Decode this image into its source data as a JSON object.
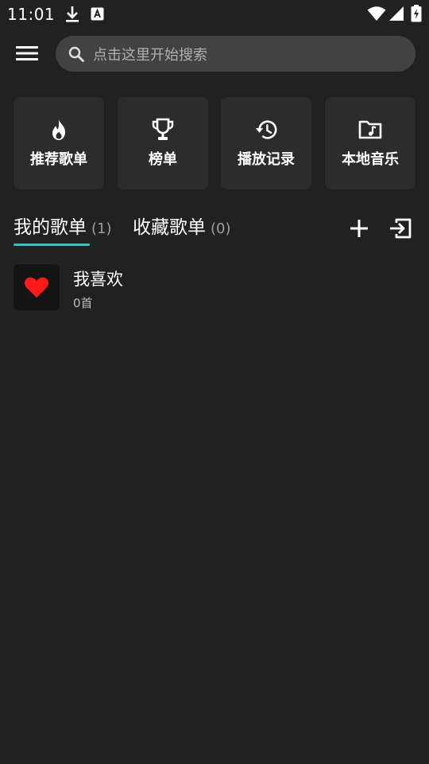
{
  "status_bar": {
    "time": "11:01",
    "icons": [
      "download-icon",
      "app-notification-icon",
      "wifi-icon",
      "signal-icon",
      "battery-charging-icon"
    ]
  },
  "top_bar": {
    "menu_icon": "hamburger-menu-icon",
    "search": {
      "icon": "search-icon",
      "placeholder": "点击这里开始搜索"
    }
  },
  "quick_access": [
    {
      "label": "推荐歌单",
      "icon": "flame-icon"
    },
    {
      "label": "榜单",
      "icon": "trophy-icon"
    },
    {
      "label": "播放记录",
      "icon": "history-icon"
    },
    {
      "label": "本地音乐",
      "icon": "music-folder-icon"
    }
  ],
  "tabs": [
    {
      "label": "我的歌单",
      "count": "(1)",
      "active": true
    },
    {
      "label": "收藏歌单",
      "count": "(0)",
      "active": false
    }
  ],
  "tab_actions": [
    "add-icon",
    "import-icon"
  ],
  "playlists": [
    {
      "title": "我喜欢",
      "subtitle": "0首",
      "icon": "heart-icon"
    }
  ],
  "colors": {
    "background": "#212121",
    "card": "#2c2c2c",
    "search_bg": "#424242",
    "accent": "#4fb3c6",
    "heart": "#ff1a1a"
  }
}
